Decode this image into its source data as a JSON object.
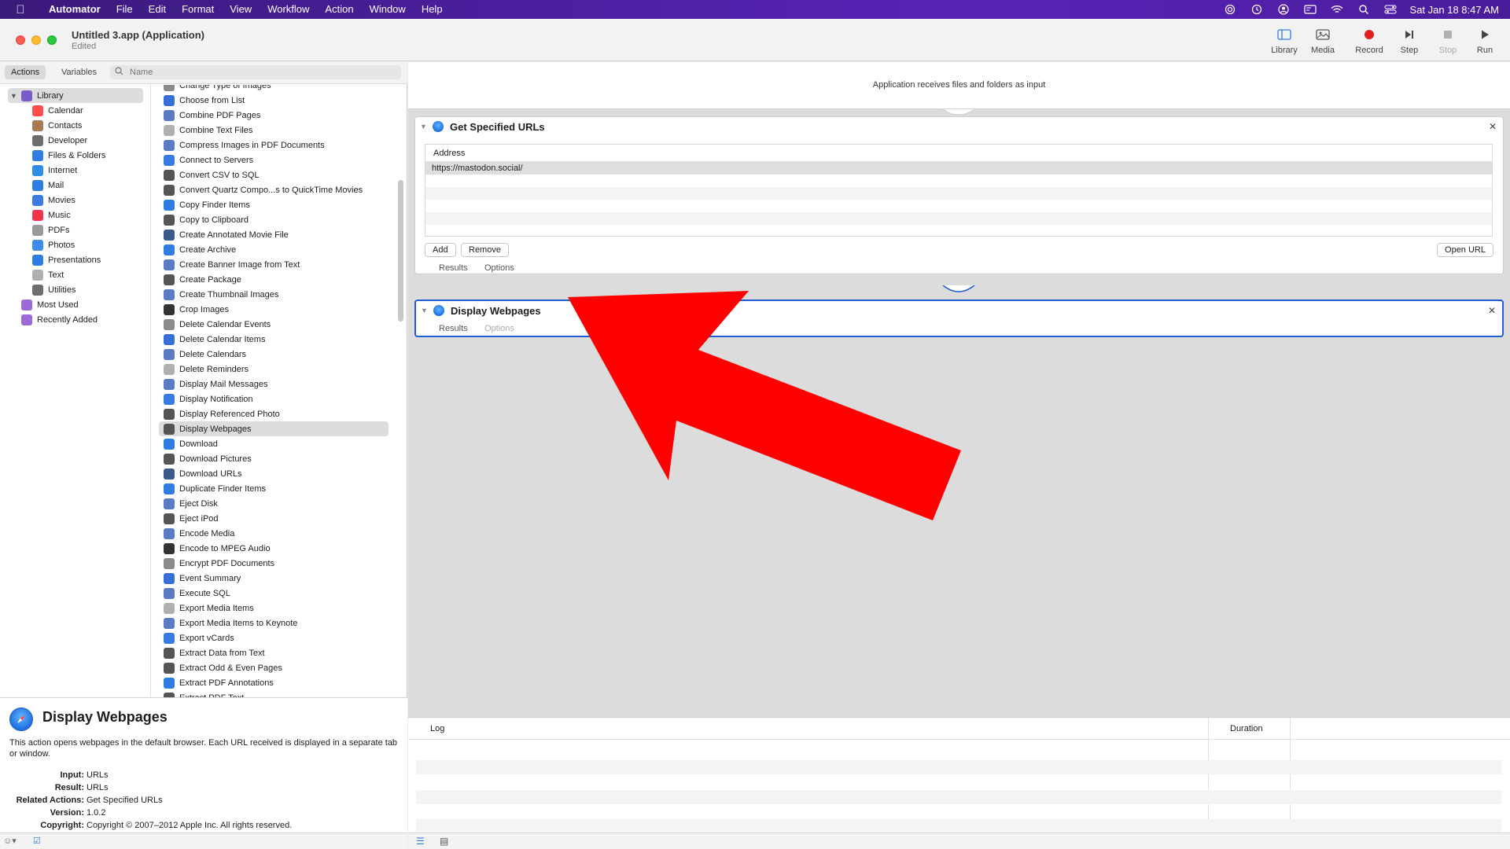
{
  "menubar": {
    "app": "Automator",
    "items": [
      "File",
      "Edit",
      "Format",
      "View",
      "Workflow",
      "Action",
      "Window",
      "Help"
    ],
    "clock": "Sat Jan 18  8:47 AM"
  },
  "window": {
    "title": "Untitled 3.app (Application)",
    "subtitle": "Edited"
  },
  "toolbar": {
    "library": "Library",
    "media": "Media",
    "record": "Record",
    "step": "Step",
    "stop": "Stop",
    "run": "Run"
  },
  "left": {
    "tabs": {
      "actions": "Actions",
      "variables": "Variables"
    },
    "search_placeholder": "Name",
    "library": [
      {
        "label": "Library",
        "color": "#7a5cc9",
        "top": false
      },
      {
        "label": "Calendar",
        "color": "#ff4d4d"
      },
      {
        "label": "Contacts",
        "color": "#a67c52"
      },
      {
        "label": "Developer",
        "color": "#6e6e6e"
      },
      {
        "label": "Files & Folders",
        "color": "#2f7de1"
      },
      {
        "label": "Internet",
        "color": "#2f8de4"
      },
      {
        "label": "Mail",
        "color": "#2f7de1"
      },
      {
        "label": "Movies",
        "color": "#3a7be0"
      },
      {
        "label": "Music",
        "color": "#f0354b"
      },
      {
        "label": "PDFs",
        "color": "#9a9a9a"
      },
      {
        "label": "Photos",
        "color": "#3d8fe6"
      },
      {
        "label": "Presentations",
        "color": "#2f7de1"
      },
      {
        "label": "Text",
        "color": "#b0b0b0"
      },
      {
        "label": "Utilities",
        "color": "#6e6e6e"
      },
      {
        "label": "Most Used",
        "color": "#9b6ad8"
      },
      {
        "label": "Recently Added",
        "color": "#9b6ad8"
      }
    ],
    "actions": [
      "Change Type of Images",
      "Choose from List",
      "Combine PDF Pages",
      "Combine Text Files",
      "Compress Images in PDF Documents",
      "Connect to Servers",
      "Convert CSV to SQL",
      "Convert Quartz Compo...s to QuickTime Movies",
      "Copy Finder Items",
      "Copy to Clipboard",
      "Create Annotated Movie File",
      "Create Archive",
      "Create Banner Image from Text",
      "Create Package",
      "Create Thumbnail Images",
      "Crop Images",
      "Delete Calendar Events",
      "Delete Calendar Items",
      "Delete Calendars",
      "Delete Reminders",
      "Display Mail Messages",
      "Display Notification",
      "Display Referenced Photo",
      "Display Webpages",
      "Download",
      "Download Pictures",
      "Download URLs",
      "Duplicate Finder Items",
      "Eject Disk",
      "Eject iPod",
      "Encode Media",
      "Encode to MPEG Audio",
      "Encrypt PDF Documents",
      "Event Summary",
      "Execute SQL",
      "Export Media Items",
      "Export Media Items to Keynote",
      "Export vCards",
      "Extract Data from Text",
      "Extract Odd & Even Pages",
      "Extract PDF Annotations",
      "Extract PDF Text"
    ],
    "selected_action": "Display Webpages"
  },
  "description": {
    "title": "Display Webpages",
    "text": "This action opens webpages in the default browser. Each URL received is displayed in a separate tab or window.",
    "meta": [
      {
        "k": "Input:",
        "v": "URLs"
      },
      {
        "k": "Result:",
        "v": "URLs"
      },
      {
        "k": "Related Actions:",
        "v": "Get Specified URLs"
      },
      {
        "k": "Version:",
        "v": "1.0.2"
      },
      {
        "k": "Copyright:",
        "v": "Copyright © 2007–2012 Apple Inc.  All rights reserved."
      }
    ]
  },
  "workflow": {
    "header": "Application receives files and folders as input",
    "action1": {
      "title": "Get Specified URLs",
      "column": "Address",
      "urls": [
        "https://mastodon.social/"
      ],
      "add": "Add",
      "remove": "Remove",
      "open_url": "Open URL",
      "results": "Results",
      "options": "Options"
    },
    "action2": {
      "title": "Display Webpages",
      "results": "Results",
      "options": "Options"
    }
  },
  "log": {
    "col_log": "Log",
    "col_duration": "Duration"
  },
  "colors": {
    "selection_blue": "#1f5fd6",
    "annotation_red": "#ff0000"
  }
}
